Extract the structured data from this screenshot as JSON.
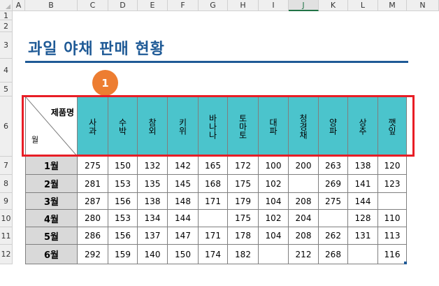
{
  "columns": [
    "A",
    "B",
    "C",
    "D",
    "E",
    "F",
    "G",
    "H",
    "I",
    "J",
    "K",
    "L",
    "M",
    "N"
  ],
  "rows": [
    "1",
    "2",
    "3",
    "4",
    "5",
    "6",
    "7",
    "8",
    "9",
    "10",
    "11",
    "12"
  ],
  "selected_column": "J",
  "title": "과일 야채 판매 현황",
  "badge": "1",
  "corner_header": {
    "top_label": "제품명",
    "bottom_label": "월"
  },
  "products": [
    "사과",
    "수박",
    "참외",
    "키위",
    "바나나",
    "토마토",
    "대파",
    "청경채",
    "양파",
    "상추",
    "깻잎"
  ],
  "months": [
    "1월",
    "2월",
    "3월",
    "4월",
    "5월",
    "6월"
  ],
  "values": [
    [
      "275",
      "150",
      "132",
      "142",
      "165",
      "172",
      "100",
      "200",
      "263",
      "138",
      "120"
    ],
    [
      "281",
      "153",
      "135",
      "145",
      "168",
      "175",
      "102",
      "",
      "269",
      "141",
      "123"
    ],
    [
      "287",
      "156",
      "138",
      "148",
      "171",
      "179",
      "104",
      "208",
      "275",
      "144",
      ""
    ],
    [
      "280",
      "153",
      "134",
      "144",
      "",
      "175",
      "102",
      "204",
      "",
      "128",
      "110"
    ],
    [
      "286",
      "156",
      "137",
      "147",
      "171",
      "178",
      "104",
      "208",
      "262",
      "131",
      "113"
    ],
    [
      "292",
      "159",
      "140",
      "150",
      "174",
      "182",
      "",
      "212",
      "268",
      "",
      "116"
    ]
  ],
  "colors": {
    "header_fill": "#4bc4cc",
    "month_fill": "#d9d9d9",
    "title": "#1f5a96",
    "badge": "#ed7d31",
    "highlight": "#e81e26"
  }
}
